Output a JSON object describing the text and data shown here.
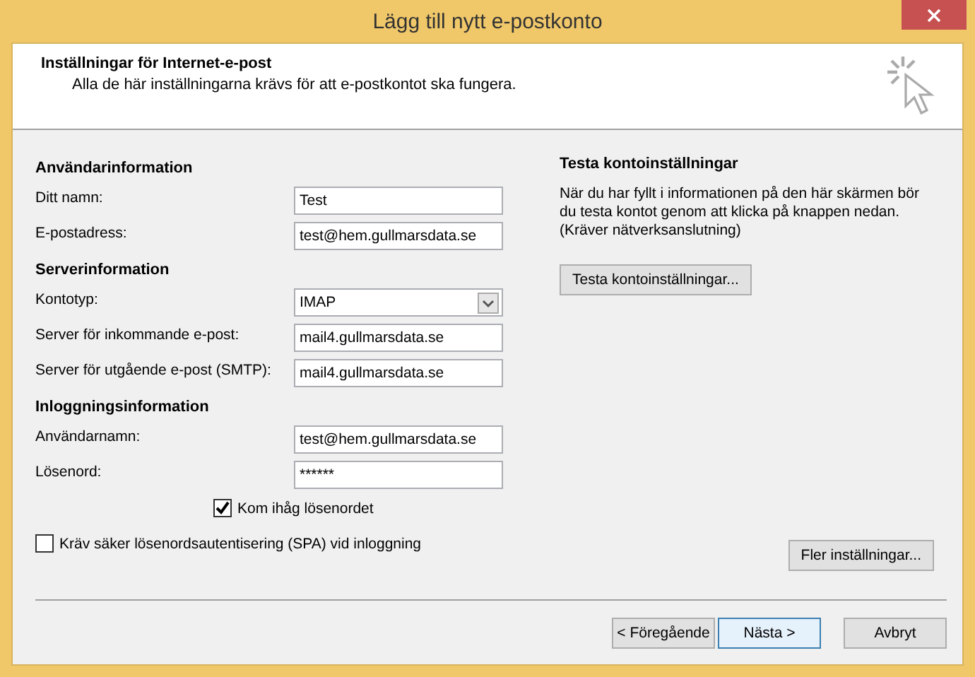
{
  "window": {
    "title": "Lägg till nytt e-postkonto"
  },
  "header": {
    "title": "Inställningar för Internet-e-post",
    "subtitle": "Alla de här inställningarna krävs för att e-postkontot ska fungera."
  },
  "sections": [
    {
      "heading": "Användarinformation",
      "fields": [
        {
          "kind": "text",
          "label": "Ditt namn:",
          "value": "Test"
        },
        {
          "kind": "text",
          "label": "E-postadress:",
          "value": "test@hem.gullmarsdata.se"
        }
      ]
    },
    {
      "heading": "Serverinformation",
      "fields": [
        {
          "kind": "dropdown",
          "label": "Kontotyp:",
          "value": "IMAP"
        },
        {
          "kind": "text",
          "label": "Server för inkommande e-post:",
          "value": "mail4.gullmarsdata.se"
        },
        {
          "kind": "text",
          "label": "Server för utgående e-post (SMTP):",
          "value": "mail4.gullmarsdata.se"
        }
      ]
    },
    {
      "heading": "Inloggningsinformation",
      "fields": [
        {
          "kind": "text",
          "label": "Användarnamn:",
          "value": "test@hem.gullmarsdata.se"
        },
        {
          "kind": "password",
          "label": "Lösenord:",
          "value": "******"
        }
      ]
    }
  ],
  "remember_password": {
    "label": "Kom ihåg lösenordet",
    "checked": true
  },
  "spa": {
    "label": "Kräv säker lösenordsautentisering (SPA) vid inloggning",
    "checked": false
  },
  "test_panel": {
    "heading": "Testa kontoinställningar",
    "text": "När du har fyllt i informationen på den här skärmen bör du testa kontot genom att klicka på knappen nedan. (Kräver nätverksanslutning)",
    "button": "Testa kontoinställningar..."
  },
  "more_settings_button": "Fler inställningar...",
  "buttons": [
    {
      "label": "< Föregående",
      "selected": false
    },
    {
      "label": "Nästa >",
      "selected": true
    },
    {
      "label": "Avbryt",
      "selected": false
    }
  ]
}
